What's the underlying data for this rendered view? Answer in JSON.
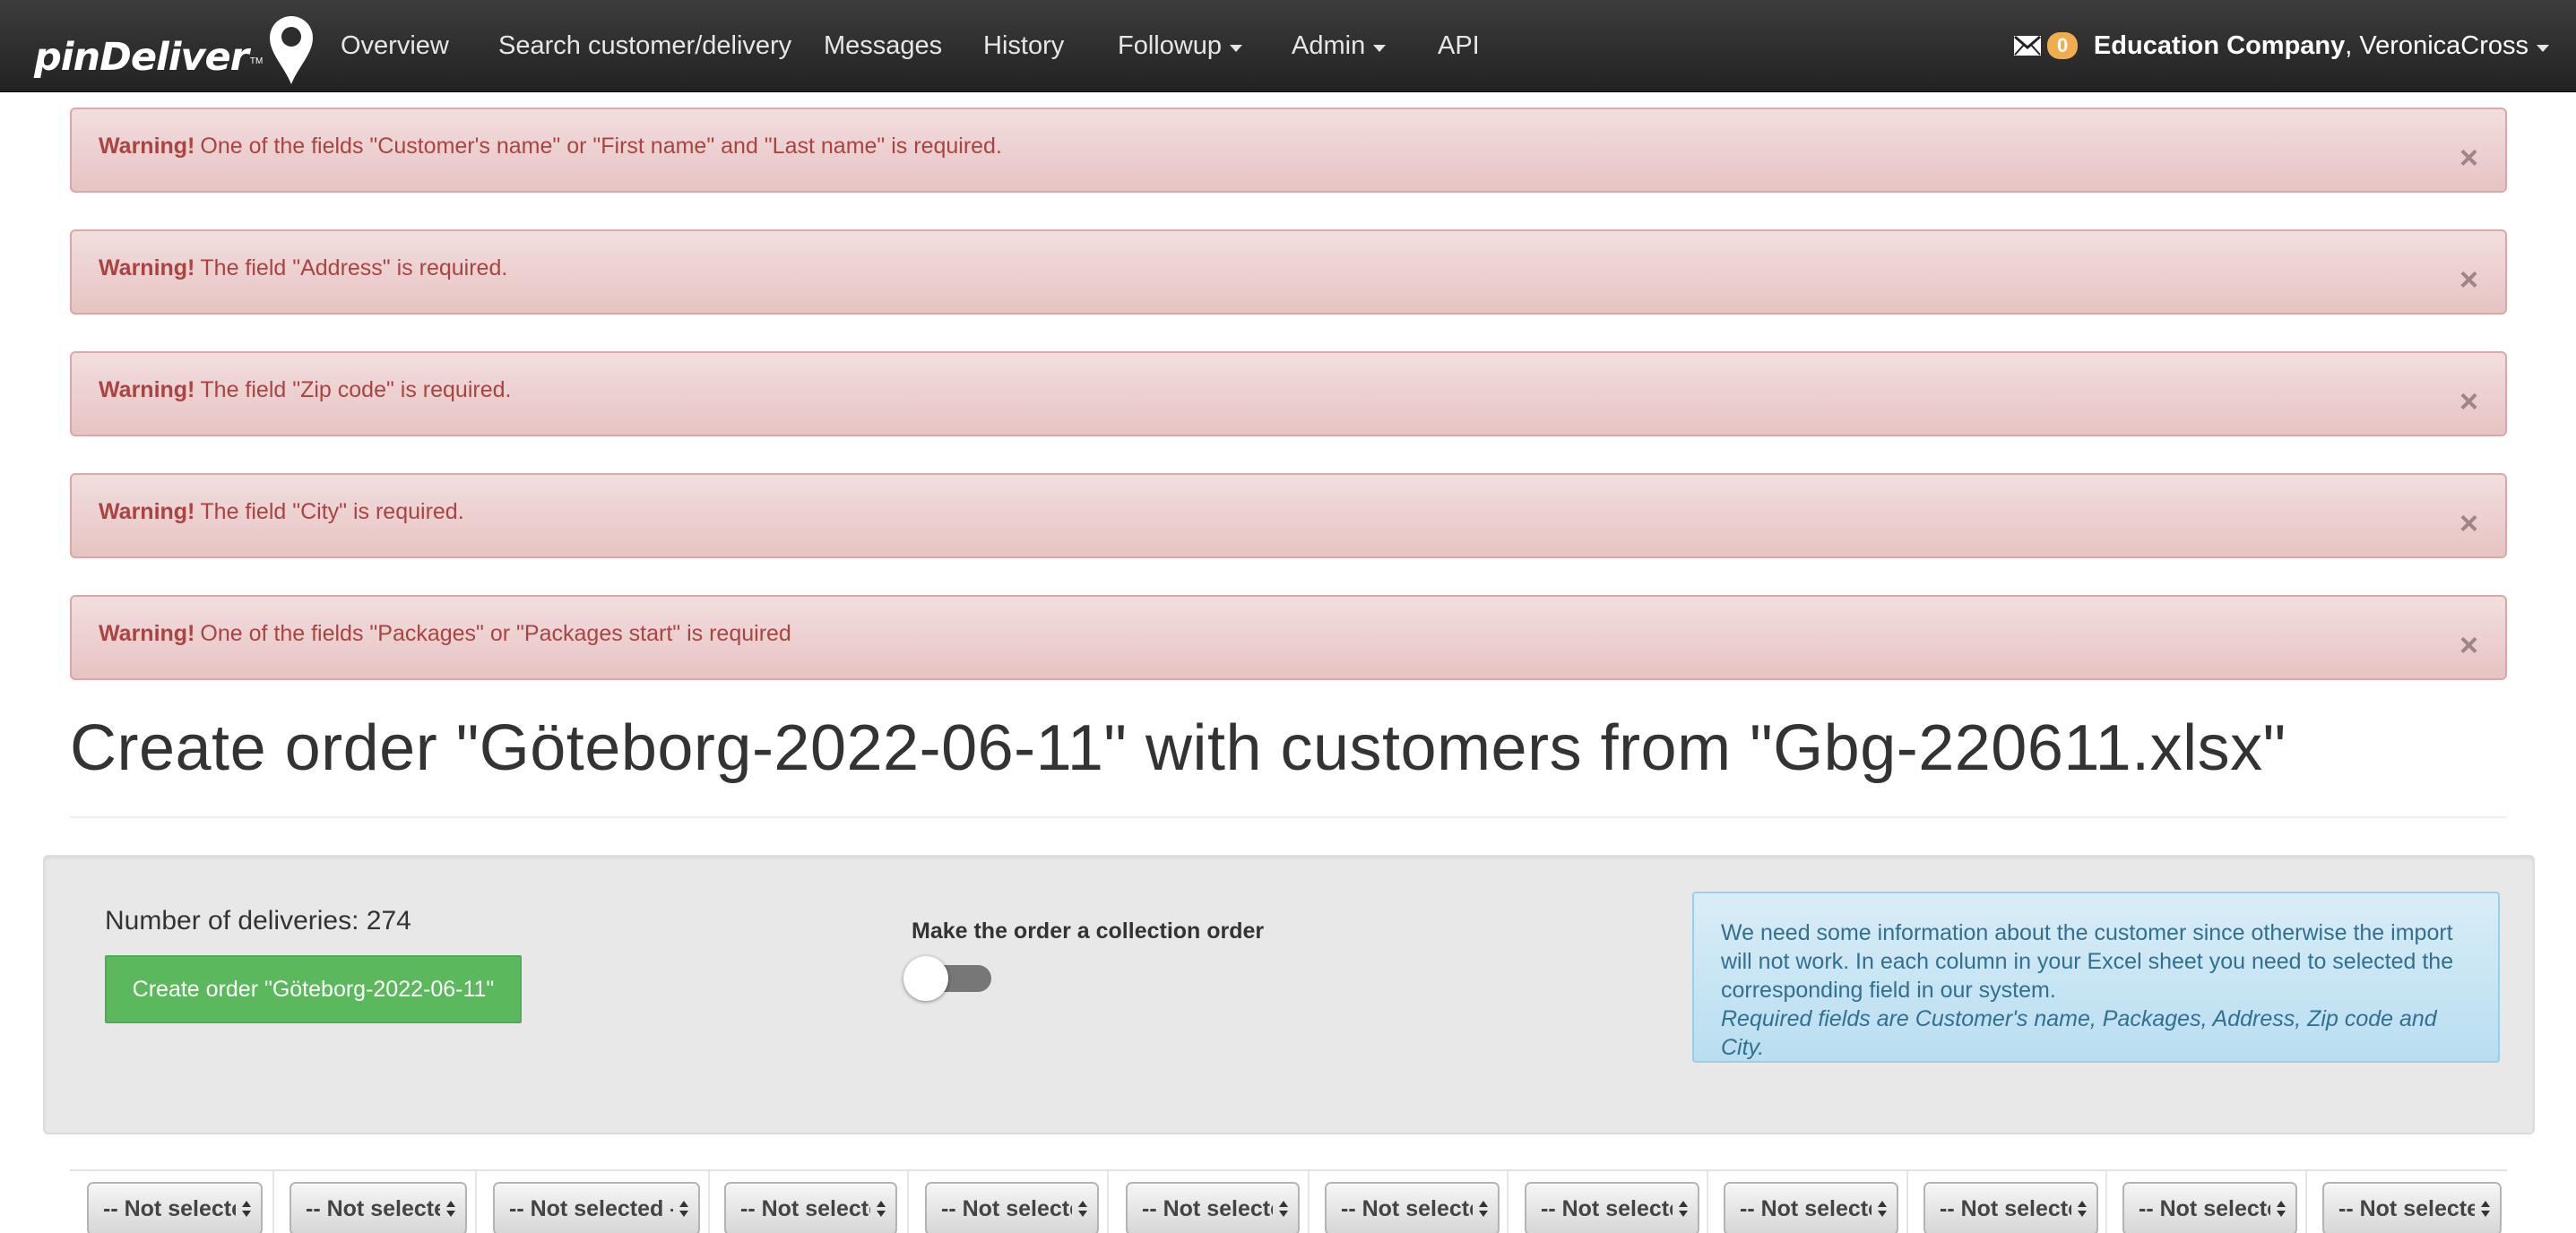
{
  "navbar": {
    "brand": "pinDeliver",
    "brand_tm": "TM",
    "items": [
      {
        "label": "Overview"
      },
      {
        "label": "Search customer/delivery"
      },
      {
        "label": "Messages"
      },
      {
        "label": "History"
      },
      {
        "label": "Followup"
      },
      {
        "label": "Admin"
      },
      {
        "label": "API"
      }
    ],
    "mail_icon": "envelope-icon",
    "unread_count": "0",
    "company": "Education Company",
    "user_separator": ", ",
    "user": "VeronicaCross"
  },
  "alerts": [
    {
      "strong": "Warning!",
      "text": "One of the fields \"Customer's name\" or \"First name\" and \"Last name\" is required.",
      "close": "×"
    },
    {
      "strong": "Warning!",
      "text": "The field \"Address\" is required.",
      "close": "×"
    },
    {
      "strong": "Warning!",
      "text": "The field \"Zip code\" is required.",
      "close": "×"
    },
    {
      "strong": "Warning!",
      "text": "The field \"City\" is required.",
      "close": "×"
    },
    {
      "strong": "Warning!",
      "text": "One of the fields \"Packages\" or \"Packages start\" is required",
      "close": "×"
    }
  ],
  "page": {
    "title": "Create order \"Göteborg-2022-06-11\" with customers from \"Gbg-220611.xlsx\""
  },
  "order": {
    "deliveries_label": "Number of deliveries: 274",
    "create_button": "Create order \"Göteborg-2022-06-11\"",
    "collection_label": "Make the order a collection order",
    "collection_enabled": false
  },
  "info": {
    "text": "We need some information about the customer since otherwise the import will not work. In each column in your Excel sheet you need to selected the corresponding field in our system.",
    "required": "Required fields are Customer's name, Packages, Address, Zip code and City."
  },
  "columns": {
    "selects": [
      "-- Not selected --",
      "-- Not selected --",
      "-- Not selected --",
      "-- Not selected --",
      "-- Not selected --",
      "-- Not selected --",
      "-- Not selected --",
      "-- Not selected --",
      "-- Not selected --",
      "-- Not selected --",
      "-- Not selected --",
      "-- Not selected --"
    ]
  }
}
